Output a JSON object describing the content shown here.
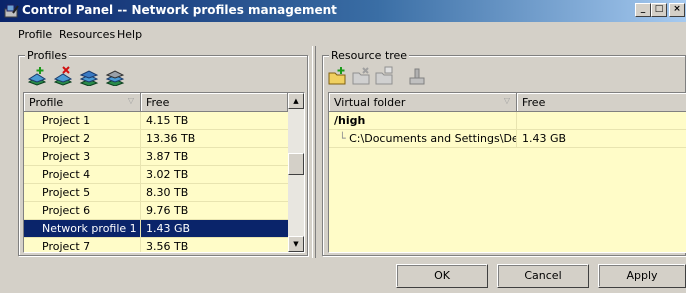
{
  "window": {
    "title": "Control Panel -- Network profiles management",
    "minimize": "_",
    "maximize": "□",
    "close": "×"
  },
  "menu": [
    "Profile",
    "Resources",
    "Help"
  ],
  "profiles": {
    "group_title": "Profiles",
    "toolbar_icons": [
      "add-profile-icon",
      "remove-profile-icon",
      "copy-profile-icon",
      "edit-profile-icon"
    ],
    "columns": [
      "Profile",
      "Free"
    ],
    "rows": [
      {
        "name": "Project 1",
        "free": "4.15 TB"
      },
      {
        "name": "Project 2",
        "free": "13.36 TB"
      },
      {
        "name": "Project 3",
        "free": "3.87 TB"
      },
      {
        "name": "Project 4",
        "free": "3.02 TB"
      },
      {
        "name": "Project 5",
        "free": "8.30 TB"
      },
      {
        "name": "Project 6",
        "free": "9.76 TB"
      },
      {
        "name": "Network profile 1",
        "free": "1.43 GB"
      },
      {
        "name": "Project 7",
        "free": "3.56 TB"
      }
    ],
    "selected_row": "Network profile 1"
  },
  "resources": {
    "group_title": "Resource tree",
    "toolbar_icons": [
      "add-folder-icon",
      "remove-folder-icon",
      "edit-folder-icon",
      "disconnect-icon"
    ],
    "columns": [
      "Virtual folder",
      "Free"
    ],
    "rows": [
      {
        "folder": "/high",
        "free": ""
      },
      {
        "folder": "C:\\Documents and Settings\\Dev\\...",
        "free": "1.43 GB"
      }
    ]
  },
  "buttons": {
    "ok": "OK",
    "cancel": "Cancel",
    "apply": "Apply"
  },
  "colors": {
    "selection": "#0a246a",
    "list_background": "#fffcc8",
    "dialog": "#d4d0c8"
  }
}
